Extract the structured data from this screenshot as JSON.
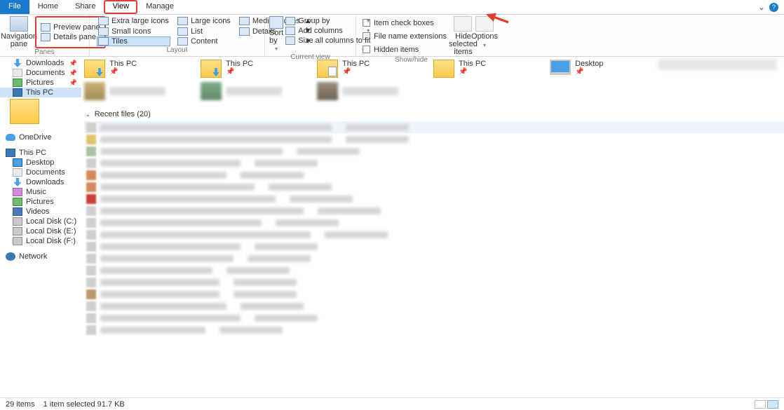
{
  "tabs": {
    "file": "File",
    "home": "Home",
    "share": "Share",
    "view": "View",
    "manage": "Manage"
  },
  "sys": {
    "chev": "⌄",
    "help": "?"
  },
  "ribbon": {
    "panes": {
      "nav": "Navigation pane",
      "preview": "Preview pane",
      "details": "Details pane",
      "group": "Panes"
    },
    "layout": {
      "xl": "Extra large icons",
      "lg": "Large icons",
      "md": "Medium icons",
      "sm": "Small icons",
      "list": "List",
      "det": "Details",
      "tiles": "Tiles",
      "content": "Content",
      "group": "Layout"
    },
    "view": {
      "sort": "Sort by",
      "groupby": "Group by",
      "addcols": "Add columns",
      "sizecols": "Size all columns to fit",
      "group": "Current view"
    },
    "show": {
      "itemcb": "Item check boxes",
      "ext": "File name extensions",
      "hidden": "Hidden items",
      "hidesel": "Hide selected items",
      "group": "Show/hide"
    },
    "options": "Options"
  },
  "sidebar": {
    "downloads": "Downloads",
    "documents": "Documents",
    "pictures": "Pictures",
    "thispc": "This PC",
    "onedrive": "OneDrive",
    "desktop": "Desktop",
    "music": "Music",
    "videos": "Videos",
    "localc": "Local Disk (C:)",
    "locale": "Local Disk (E:)",
    "localf": "Local Disk (F:)",
    "network": "Network"
  },
  "folders": {
    "thispc": "This PC",
    "desktop": "Desktop",
    "pinned": "📌"
  },
  "recent_header": "Recent files (20)",
  "status": {
    "count": "29 items",
    "sel": "1 item selected  91.7 KB"
  }
}
